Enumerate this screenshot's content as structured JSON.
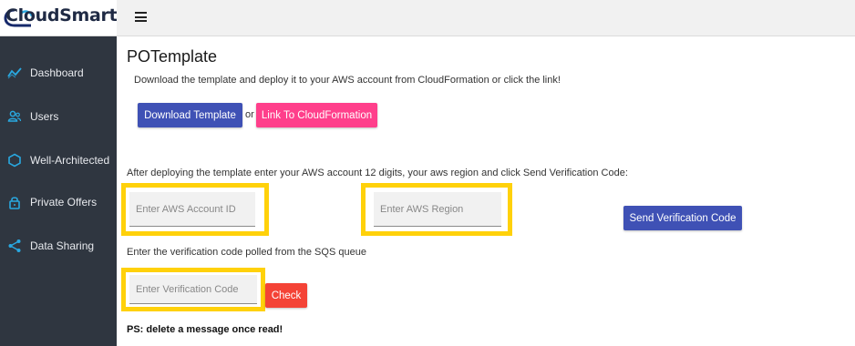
{
  "app": {
    "logo_text": "CloudSmart"
  },
  "sidebar": {
    "items": [
      {
        "label": "Dashboard",
        "icon": "chart-line-icon"
      },
      {
        "label": "Users",
        "icon": "users-icon"
      },
      {
        "label": "Well-Architected",
        "icon": "hexagon-icon"
      },
      {
        "label": "Private Offers",
        "icon": "lock-icon"
      },
      {
        "label": "Data Sharing",
        "icon": "share-icon"
      }
    ]
  },
  "main": {
    "title": "POTemplate",
    "intro": "Download the template and deploy it to your AWS account from CloudFormation or click the link!",
    "download_button": "Download Template",
    "or_text": "or",
    "cloudformation_button": "Link To CloudFormation",
    "deploy_instructions": "After deploying the template enter your AWS account 12 digits, your aws region and click Send Verification Code:",
    "account_id_placeholder": "Enter AWS Account ID",
    "region_placeholder": "Enter AWS Region",
    "send_button": "Send Verification Code",
    "verification_instructions": "Enter the verification code polled from the SQS queue",
    "verification_placeholder": "Enter Verification Code",
    "check_button": "Check",
    "ps_note": "PS: delete a message once read!"
  },
  "colors": {
    "sidebar_bg": "#2f3640",
    "primary": "#3f51b5",
    "pink": "#ff3f8b",
    "danger": "#f44336",
    "highlight": "#ffd10a",
    "icon_blue": "#29a8e0"
  }
}
